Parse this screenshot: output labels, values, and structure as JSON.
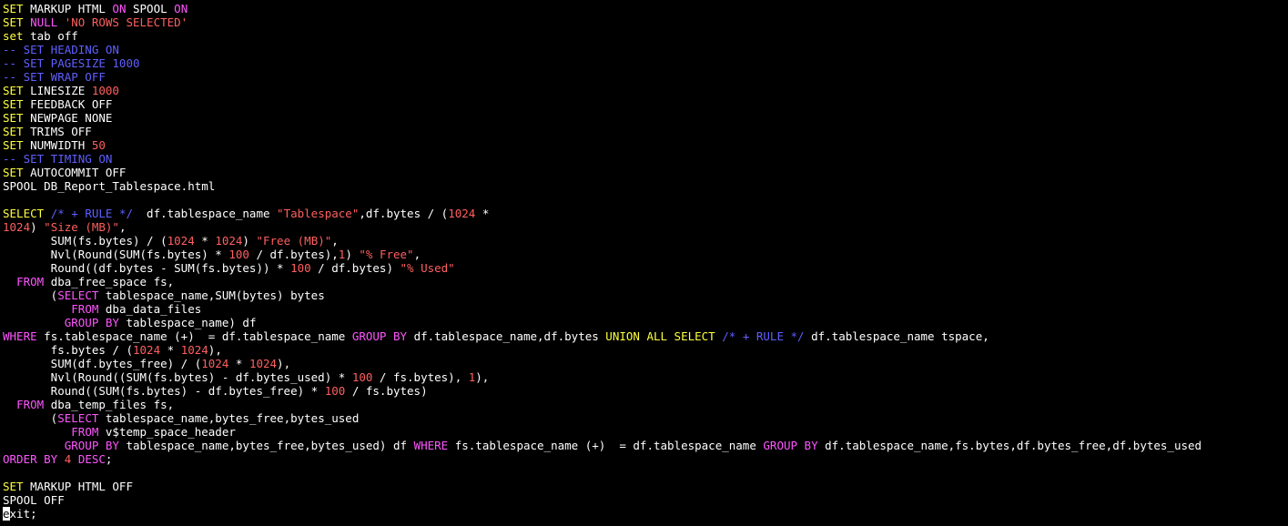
{
  "editor": {
    "background": "#000000",
    "colors": {
      "plain": "#ffffff",
      "keyword": "#ffff40",
      "sql_keyword": "#ff55ff",
      "string": "#ff5f5f",
      "number": "#ff5f5f",
      "comment": "#5f5fff"
    },
    "cursor_position": {
      "line": 37,
      "column": 1
    },
    "lines": [
      [
        [
          "kw",
          "SET"
        ],
        [
          "pl",
          " MARKUP HTML "
        ],
        [
          "pk",
          "ON"
        ],
        [
          "pl",
          " SPOOL "
        ],
        [
          "pk",
          "ON"
        ]
      ],
      [
        [
          "kw",
          "SET"
        ],
        [
          "pl",
          " "
        ],
        [
          "pk",
          "NULL"
        ],
        [
          "pl",
          " "
        ],
        [
          "str",
          "'NO ROWS SELECTED'"
        ]
      ],
      [
        [
          "kw",
          "set"
        ],
        [
          "pl",
          " tab off"
        ]
      ],
      [
        [
          "cm",
          "-- SET HEADING ON"
        ]
      ],
      [
        [
          "cm",
          "-- SET PAGESIZE 1000"
        ]
      ],
      [
        [
          "cm",
          "-- SET WRAP OFF"
        ]
      ],
      [
        [
          "kw",
          "SET"
        ],
        [
          "pl",
          " LINESIZE "
        ],
        [
          "num",
          "1000"
        ]
      ],
      [
        [
          "kw",
          "SET"
        ],
        [
          "pl",
          " FEEDBACK OFF"
        ]
      ],
      [
        [
          "kw",
          "SET"
        ],
        [
          "pl",
          " NEWPAGE NONE"
        ]
      ],
      [
        [
          "kw",
          "SET"
        ],
        [
          "pl",
          " TRIMS OFF"
        ]
      ],
      [
        [
          "kw",
          "SET"
        ],
        [
          "pl",
          " NUMWIDTH "
        ],
        [
          "num",
          "50"
        ]
      ],
      [
        [
          "cm",
          "-- SET TIMING ON"
        ]
      ],
      [
        [
          "kw",
          "SET"
        ],
        [
          "pl",
          " AUTOCOMMIT OFF"
        ]
      ],
      [
        [
          "pl",
          "SPOOL DB_Report_Tablespace.html"
        ]
      ],
      [
        [
          "pl",
          ""
        ]
      ],
      [
        [
          "kw",
          "SELECT"
        ],
        [
          "pl",
          " "
        ],
        [
          "cm",
          "/* + RULE */"
        ],
        [
          "pl",
          "  df.tablespace_name "
        ],
        [
          "str",
          "\"Tablespace\""
        ],
        [
          "pl",
          ",df.bytes / ("
        ],
        [
          "num",
          "1024"
        ],
        [
          "pl",
          " *"
        ]
      ],
      [
        [
          "num",
          "1024"
        ],
        [
          "pl",
          ") "
        ],
        [
          "str",
          "\"Size (MB)\""
        ],
        [
          "pl",
          ","
        ]
      ],
      [
        [
          "pl",
          "       SUM(fs.bytes) / ("
        ],
        [
          "num",
          "1024"
        ],
        [
          "pl",
          " * "
        ],
        [
          "num",
          "1024"
        ],
        [
          "pl",
          ") "
        ],
        [
          "str",
          "\"Free (MB)\""
        ],
        [
          "pl",
          ","
        ]
      ],
      [
        [
          "pl",
          "       Nvl(Round(SUM(fs.bytes) * "
        ],
        [
          "num",
          "100"
        ],
        [
          "pl",
          " / df.bytes),"
        ],
        [
          "num",
          "1"
        ],
        [
          "pl",
          ") "
        ],
        [
          "str",
          "\"% Free\""
        ],
        [
          "pl",
          ","
        ]
      ],
      [
        [
          "pl",
          "       Round((df.bytes - SUM(fs.bytes)) * "
        ],
        [
          "num",
          "100"
        ],
        [
          "pl",
          " / df.bytes) "
        ],
        [
          "str",
          "\"% Used\""
        ]
      ],
      [
        [
          "pl",
          "  "
        ],
        [
          "pk",
          "FROM"
        ],
        [
          "pl",
          " dba_free_space fs,"
        ]
      ],
      [
        [
          "pl",
          "       ("
        ],
        [
          "pk",
          "SELECT"
        ],
        [
          "pl",
          " tablespace_name,SUM(bytes) bytes"
        ]
      ],
      [
        [
          "pl",
          "          "
        ],
        [
          "pk",
          "FROM"
        ],
        [
          "pl",
          " dba_data_files"
        ]
      ],
      [
        [
          "pl",
          "         "
        ],
        [
          "pk",
          "GROUP BY"
        ],
        [
          "pl",
          " tablespace_name) df"
        ]
      ],
      [
        [
          "pk",
          "WHERE"
        ],
        [
          "pl",
          " fs.tablespace_name (+)  = df.tablespace_name "
        ],
        [
          "pk",
          "GROUP BY"
        ],
        [
          "pl",
          " df.tablespace_name,df.bytes "
        ],
        [
          "kw",
          "UNION ALL SELECT"
        ],
        [
          "pl",
          " "
        ],
        [
          "cm",
          "/* + RULE */"
        ],
        [
          "pl",
          " df.tablespace_name tspace,"
        ]
      ],
      [
        [
          "pl",
          "       fs.bytes / ("
        ],
        [
          "num",
          "1024"
        ],
        [
          "pl",
          " * "
        ],
        [
          "num",
          "1024"
        ],
        [
          "pl",
          "),"
        ]
      ],
      [
        [
          "pl",
          "       SUM(df.bytes_free) / ("
        ],
        [
          "num",
          "1024"
        ],
        [
          "pl",
          " * "
        ],
        [
          "num",
          "1024"
        ],
        [
          "pl",
          "),"
        ]
      ],
      [
        [
          "pl",
          "       Nvl(Round((SUM(fs.bytes) - df.bytes_used) * "
        ],
        [
          "num",
          "100"
        ],
        [
          "pl",
          " / fs.bytes), "
        ],
        [
          "num",
          "1"
        ],
        [
          "pl",
          "),"
        ]
      ],
      [
        [
          "pl",
          "       Round((SUM(fs.bytes) - df.bytes_free) * "
        ],
        [
          "num",
          "100"
        ],
        [
          "pl",
          " / fs.bytes)"
        ]
      ],
      [
        [
          "pl",
          "  "
        ],
        [
          "pk",
          "FROM"
        ],
        [
          "pl",
          " dba_temp_files fs,"
        ]
      ],
      [
        [
          "pl",
          "       ("
        ],
        [
          "pk",
          "SELECT"
        ],
        [
          "pl",
          " tablespace_name,bytes_free,bytes_used"
        ]
      ],
      [
        [
          "pl",
          "          "
        ],
        [
          "pk",
          "FROM"
        ],
        [
          "pl",
          " v$temp_space_header"
        ]
      ],
      [
        [
          "pl",
          "         "
        ],
        [
          "pk",
          "GROUP BY"
        ],
        [
          "pl",
          " tablespace_name,bytes_free,bytes_used) df "
        ],
        [
          "pk",
          "WHERE"
        ],
        [
          "pl",
          " fs.tablespace_name (+)  = df.tablespace_name "
        ],
        [
          "pk",
          "GROUP BY"
        ],
        [
          "pl",
          " df.tablespace_name,fs.bytes,df.bytes_free,df.bytes_used"
        ]
      ],
      [
        [
          "pk",
          "ORDER BY"
        ],
        [
          "pl",
          " "
        ],
        [
          "num",
          "4"
        ],
        [
          "pl",
          " "
        ],
        [
          "pk",
          "DESC"
        ],
        [
          "pl",
          ";"
        ]
      ],
      [
        [
          "pl",
          ""
        ]
      ],
      [
        [
          "kw",
          "SET"
        ],
        [
          "pl",
          " MARKUP HTML OFF"
        ]
      ],
      [
        [
          "pl",
          "SPOOL OFF"
        ]
      ],
      [
        [
          "cur",
          "e"
        ],
        [
          "pl",
          "xit;"
        ]
      ]
    ]
  }
}
